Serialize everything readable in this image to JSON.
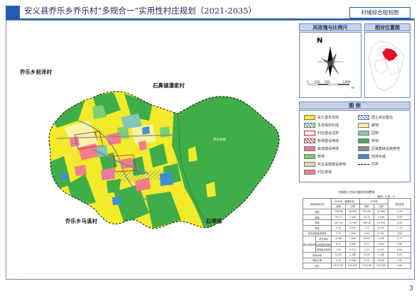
{
  "header": {
    "title": "安义县乔乐乡乔乐村“多规合一”实用性村庄规划（2021-2035）",
    "tag": "村域综合规划图"
  },
  "map": {
    "labels": {
      "qianze": "乔乐乡前泽村",
      "panjia": "石鼻镇潘家村",
      "maxi": "乔乐乡马溪村",
      "shibi": "石埠镇",
      "forest_text": "乔乐林场"
    }
  },
  "panels": {
    "scale_head": "风玫瑰与比例尺",
    "location_head": "相对位置图",
    "legend_head": "图  例",
    "north_letter": "N",
    "scale_ticks": [
      "0",
      "250",
      "500",
      "1,000"
    ],
    "scale_unit": "m"
  },
  "legend": {
    "items_left": [
      {
        "label": "永久基本农田",
        "color": "#f2ea2a"
      },
      {
        "label": "生态保护红线",
        "color": "#ffffff",
        "pattern": "hatch-green"
      },
      {
        "label": "村庄建设边界",
        "color": "#ffffff",
        "pattern": "outline-red"
      },
      {
        "label": "新增建设用地",
        "color": "#ffffff",
        "pattern": "cross-red"
      },
      {
        "label": "其他建设用地",
        "color": "#e87aa0"
      },
      {
        "label": "草地",
        "color": "#7fcf74"
      },
      {
        "label": "农业设施建设用地",
        "color": "#e4dba0"
      },
      {
        "label": "村庄用地",
        "color": "#f27d8a"
      }
    ],
    "items_right": [
      {
        "label": "国土综合整治",
        "color": "#ffffff",
        "pattern": "hatch-blue"
      },
      {
        "label": "耕地",
        "color": "#f7f2a6"
      },
      {
        "label": "园地",
        "color": "#82c7b8"
      },
      {
        "label": "林地",
        "color": "#3fae48"
      },
      {
        "label": "区域基础设施用地",
        "color": "#8a8a8a"
      },
      {
        "label": "陆地水域",
        "color": "#3f8fd2"
      },
      {
        "label": "村界",
        "color": "#000000",
        "pattern": "dash"
      }
    ]
  },
  "colors": {
    "accent": "#1f5fb0",
    "panel_head_bg": "#c6d2ea",
    "forest": "#3fae48",
    "farmland": "#f2ea2a",
    "village": "#f27d8a",
    "water": "#3f8fd2"
  },
  "table": {
    "title": "村域国土空间功能结构调整表",
    "unit": "面积：公顷，%",
    "header1": [
      "用地用海分类",
      "",
      "2020年（基期年份）",
      "",
      "2035年",
      "",
      "变化情况"
    ],
    "header2": [
      "",
      "",
      "面积",
      "比例",
      "面积",
      "比例",
      ""
    ],
    "rows": [
      [
        "耕地",
        "",
        "538.96",
        "26.556",
        "523.40",
        "25.989",
        "-0.00"
      ],
      [
        "园地",
        "",
        "30.71",
        "1.509",
        "30.71",
        "1.526",
        "0.00"
      ],
      [
        "林地",
        "",
        "267.39",
        "13.146",
        "266.40",
        "13.193",
        "-0.03"
      ],
      [
        "草地",
        "",
        "2.33",
        "0.109",
        "1.73",
        "0.103",
        "-1.72"
      ],
      [
        "农业设施建设用地",
        "",
        "2.73",
        "1.848",
        "4.30",
        "0.252",
        "3.69"
      ],
      [
        "城乡建设用地",
        "村庄用地",
        "42.88",
        "2.089",
        "49.81",
        "2.576",
        "-2.27"
      ],
      [
        "",
        "区域基础设施用地",
        "6.11",
        "0.909",
        "6.11",
        "0.909",
        "0.00"
      ],
      [
        "",
        "其他建设用地",
        "1.52",
        "0.075",
        "1.52",
        "0.075",
        "0.00"
      ],
      [
        "陆地水域",
        "",
        "24.05",
        "1.188",
        "24.05",
        "1.186",
        "0.00"
      ],
      [
        "其他土地",
        "",
        "0.12",
        "0.006",
        "0.12",
        "0.006",
        "0.00"
      ],
      [
        "总计",
        "",
        "2015.38",
        "100.000",
        "2015.38",
        "100.000",
        "0.00"
      ]
    ]
  },
  "page_number": "3"
}
